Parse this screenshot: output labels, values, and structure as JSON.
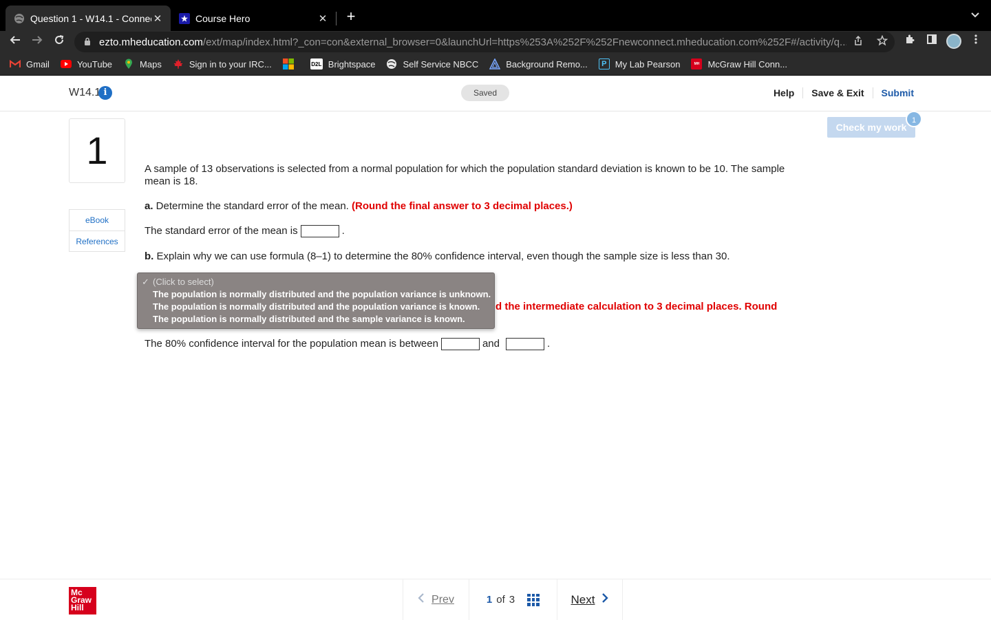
{
  "browser": {
    "tabs": [
      {
        "title": "Question 1 - W14.1 - Connect",
        "active": true
      },
      {
        "title": "Course Hero",
        "active": false
      }
    ],
    "url_host": "ezto.mheducation.com",
    "url_path": "/ext/map/index.html?_con=con&external_browser=0&launchUrl=https%253A%252F%252Fnewconnect.mheducation.com%252F#/activity/q...",
    "bookmarks": [
      "Gmail",
      "YouTube",
      "Maps",
      "Sign in to your IRC...",
      "Brightspace",
      "Self Service NBCC",
      "Background Remo...",
      "My Lab Pearson",
      "McGraw Hill Conn..."
    ]
  },
  "header": {
    "assignment_title": "W14.1",
    "saved_label": "Saved",
    "help": "Help",
    "save_exit": "Save & Exit",
    "submit": "Submit"
  },
  "sidebar": {
    "question_number": "1",
    "ebook": "eBook",
    "references": "References"
  },
  "check_work": {
    "label": "Check my work",
    "badge": "1"
  },
  "question": {
    "intro": "A sample of 13 observations is selected from a normal population for which the population standard deviation is known to be 10. The sample mean is 18.",
    "a_label": "a.",
    "a_text": " Determine the standard error of the mean. ",
    "a_instruction": "(Round the final answer to 3 decimal places.)",
    "a_answer_prefix": "The standard error of the mean is",
    "a_answer_suffix": ".",
    "b_label": "b.",
    "b_text": " Explain why we can use formula (8–1) to determine the 80% confidence interval, even though the sample size is less than 30.",
    "c_instruction_visible": "d the intermediate calculation to 3 decimal places. Round",
    "c_answer_prefix": "The 80% confidence interval for the population mean is between",
    "c_answer_and": "and",
    "c_answer_suffix": "."
  },
  "dropdown": {
    "placeholder": "(Click to select)",
    "options": [
      "The population is normally distributed and the population variance is unknown.",
      "The population is normally distributed and the population variance is known.",
      "The population is normally distributed and the sample variance is known."
    ]
  },
  "footer": {
    "logo_lines": [
      "Mc",
      "Graw",
      "Hill"
    ],
    "prev": "Prev",
    "current_page": "1",
    "of": "of",
    "total_pages": "3",
    "next": "Next"
  }
}
